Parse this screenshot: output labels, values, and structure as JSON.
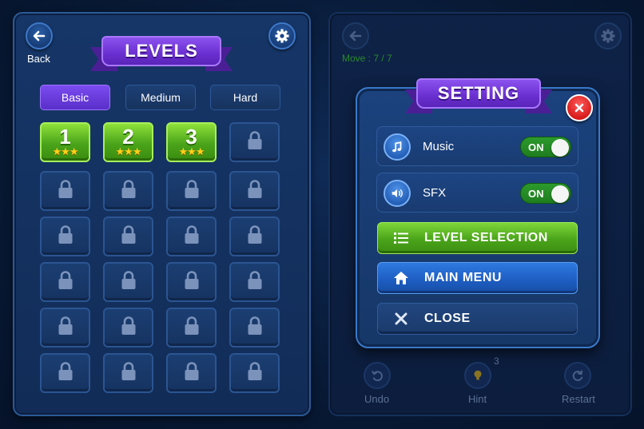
{
  "levels_screen": {
    "back_label": "Back",
    "title": "LEVELS",
    "tabs": [
      {
        "label": "Basic",
        "active": true
      },
      {
        "label": "Medium",
        "active": false
      },
      {
        "label": "Hard",
        "active": false
      }
    ],
    "unlocked_levels": [
      {
        "number": "1",
        "stars": "★★★"
      },
      {
        "number": "2",
        "stars": "★★★"
      },
      {
        "number": "3",
        "stars": "★★★"
      }
    ],
    "total_slots": 24
  },
  "game_screen": {
    "moves_text": "Move : 7 / 7",
    "hint_count": "3",
    "bottom_buttons": [
      {
        "label": "Undo",
        "icon": "undo-icon"
      },
      {
        "label": "Hint",
        "icon": "lightbulb-icon"
      },
      {
        "label": "Restart",
        "icon": "restart-icon"
      }
    ]
  },
  "setting_dialog": {
    "title": "SETTING",
    "rows": [
      {
        "label": "Music",
        "icon": "music-note-icon",
        "toggle": "ON"
      },
      {
        "label": "SFX",
        "icon": "speaker-icon",
        "toggle": "ON"
      }
    ],
    "buttons": [
      {
        "label": "LEVEL SELECTION",
        "icon": "list-icon",
        "color": "#4aa41a"
      },
      {
        "label": "MAIN MENU",
        "icon": "home-icon",
        "color": "#1d5cc0"
      },
      {
        "label": "CLOSE",
        "icon": "close-icon",
        "color": "#1a3a6b"
      }
    ]
  },
  "colors": {
    "accent_purple": "#6a2fd0",
    "unlocked_green": "#4aa41a",
    "star_yellow": "#ffd21a",
    "close_red": "#d81c1c",
    "panel_blue": "#163668"
  }
}
